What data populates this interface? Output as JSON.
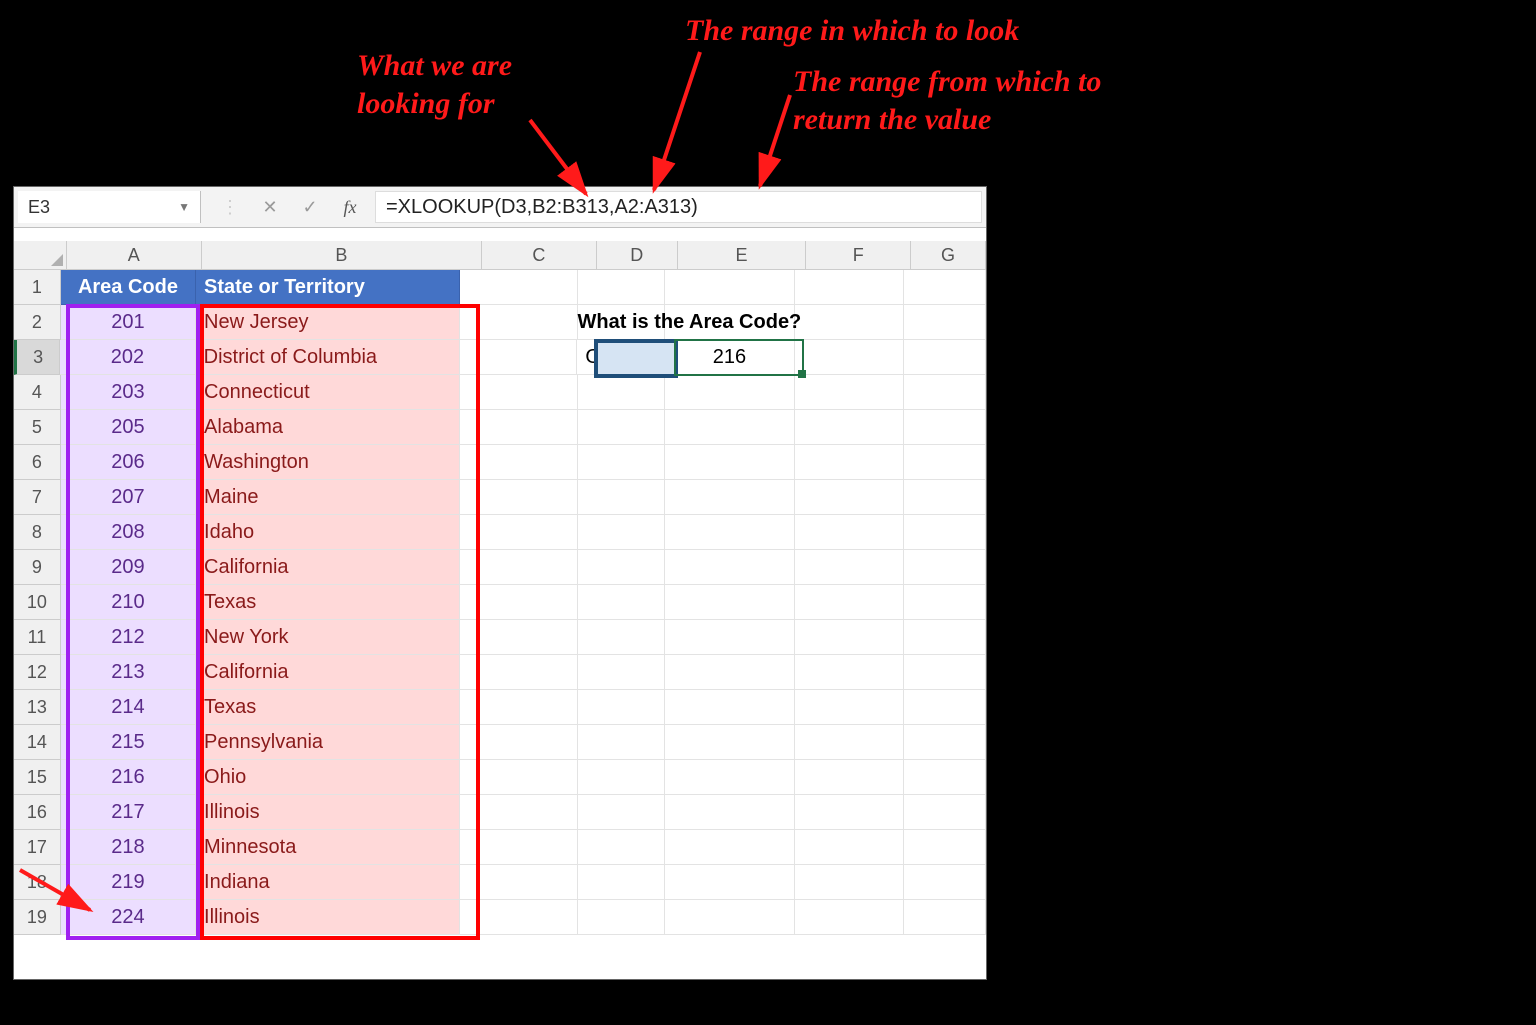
{
  "annotations": {
    "a1": "What we are",
    "a1b": "looking for",
    "a2": "The range in which to look",
    "a3": "The range from which to",
    "a3b": "return the value"
  },
  "namebox": "E3",
  "formula": "=XLOOKUP(D3,B2:B313,A2:A313)",
  "fx_label": "fx",
  "cols": [
    "A",
    "B",
    "C",
    "D",
    "E",
    "F",
    "G"
  ],
  "header": {
    "A": "Area Code",
    "B": "State or Territory"
  },
  "rows": [
    {
      "n": 2,
      "code": "201",
      "state": "New Jersey"
    },
    {
      "n": 3,
      "code": "202",
      "state": "District of Columbia"
    },
    {
      "n": 4,
      "code": "203",
      "state": "Connecticut"
    },
    {
      "n": 5,
      "code": "205",
      "state": "Alabama"
    },
    {
      "n": 6,
      "code": "206",
      "state": "Washington"
    },
    {
      "n": 7,
      "code": "207",
      "state": "Maine"
    },
    {
      "n": 8,
      "code": "208",
      "state": "Idaho"
    },
    {
      "n": 9,
      "code": "209",
      "state": "California"
    },
    {
      "n": 10,
      "code": "210",
      "state": "Texas"
    },
    {
      "n": 11,
      "code": "212",
      "state": "New York"
    },
    {
      "n": 12,
      "code": "213",
      "state": "California"
    },
    {
      "n": 13,
      "code": "214",
      "state": "Texas"
    },
    {
      "n": 14,
      "code": "215",
      "state": "Pennsylvania"
    },
    {
      "n": 15,
      "code": "216",
      "state": "Ohio"
    },
    {
      "n": 16,
      "code": "217",
      "state": "Illinois"
    },
    {
      "n": 17,
      "code": "218",
      "state": "Minnesota"
    },
    {
      "n": 18,
      "code": "219",
      "state": "Indiana"
    },
    {
      "n": 19,
      "code": "224",
      "state": "Illinois"
    }
  ],
  "question": "What is the Area Code?",
  "d3": "Ohio",
  "e3": "216"
}
